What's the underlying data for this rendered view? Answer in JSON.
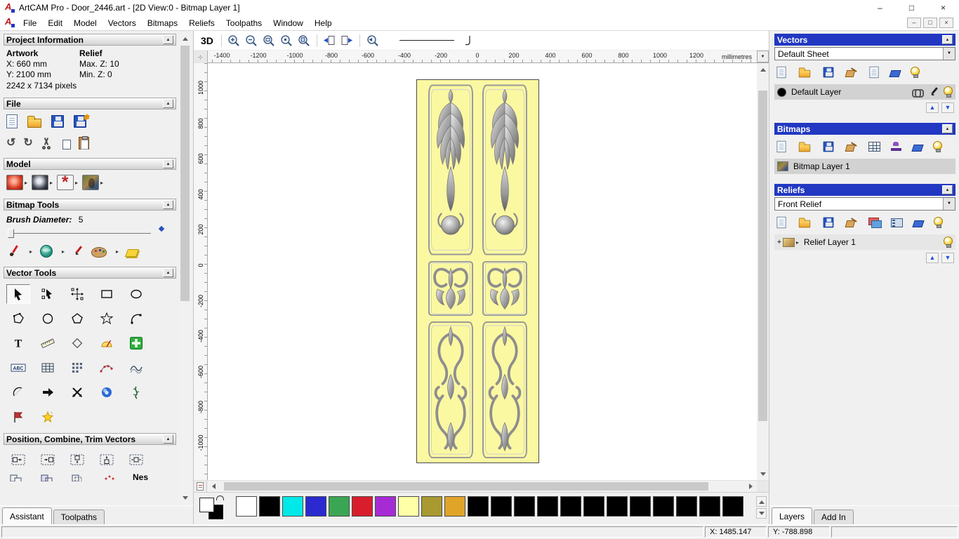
{
  "window": {
    "title": "ArtCAM Pro - Door_2446.art - [2D View:0 - Bitmap Layer 1]",
    "logo_letter": "A"
  },
  "menu": {
    "items": [
      "File",
      "Edit",
      "Model",
      "Vectors",
      "Bitmaps",
      "Reliefs",
      "Toolpaths",
      "Window",
      "Help"
    ]
  },
  "assistant": {
    "project": {
      "header": "Project Information",
      "artwork_label": "Artwork",
      "artwork_x": "X: 660 mm",
      "artwork_y": "Y: 2100 mm",
      "artwork_pixels": "2242 x 7134 pixels",
      "relief_label": "Relief",
      "relief_max_z": "Max. Z: 10",
      "relief_min_z": "Min. Z: 0"
    },
    "file_header": "File",
    "model_header": "Model",
    "bitmap_tools_header": "Bitmap Tools",
    "brush_diameter_label": "Brush Diameter:",
    "brush_diameter_value": "5",
    "vector_tools_header": "Vector Tools",
    "position_header": "Position, Combine, Trim Vectors",
    "nest_label": "Nes",
    "tab_assistant": "Assistant",
    "tab_toolpaths": "Toolpaths"
  },
  "canvas": {
    "view_3d_label": "3D",
    "ruler_units": "millimetres",
    "h_ticks": [
      -1400,
      -1200,
      -1000,
      -800,
      -600,
      -400,
      -200,
      0,
      200,
      400,
      600,
      800,
      1000,
      1200
    ],
    "v_ticks": [
      1000,
      800,
      600,
      400,
      200,
      0,
      -200,
      -400,
      -600,
      -800,
      -1000
    ]
  },
  "layers_panel": {
    "vectors_header": "Vectors",
    "sheet_value": "Default Sheet",
    "vector_layer_name": "Default Layer",
    "bitmaps_header": "Bitmaps",
    "bitmap_layer_name": "Bitmap Layer 1",
    "reliefs_header": "Reliefs",
    "relief_value": "Front Relief",
    "relief_layer_name": "Relief Layer 1",
    "tab_layers": "Layers",
    "tab_addin": "Add In"
  },
  "palette": {
    "colors": [
      "#ffffff",
      "#000000",
      "#00e8e8",
      "#2a2ad0",
      "#3aa653",
      "#d81e2c",
      "#a62bd4",
      "#ffffa8",
      "#a89a30",
      "#e0a428",
      "#000000",
      "#000000",
      "#000000",
      "#000000",
      "#000000",
      "#000000",
      "#000000",
      "#000000",
      "#000000",
      "#000000",
      "#000000",
      "#000000"
    ],
    "foreground": "#ffffff",
    "background": "#000000"
  },
  "status": {
    "x": "X: 1485.147",
    "y": "Y: -788.898"
  },
  "icons": {
    "undo": "↺",
    "redo": "↻",
    "flyout": "▸",
    "dropdown": "▼",
    "collapse": "▲",
    "up": "▲",
    "down": "▼",
    "minimize": "–",
    "maximize": "□",
    "close": "×",
    "plus": "+"
  }
}
